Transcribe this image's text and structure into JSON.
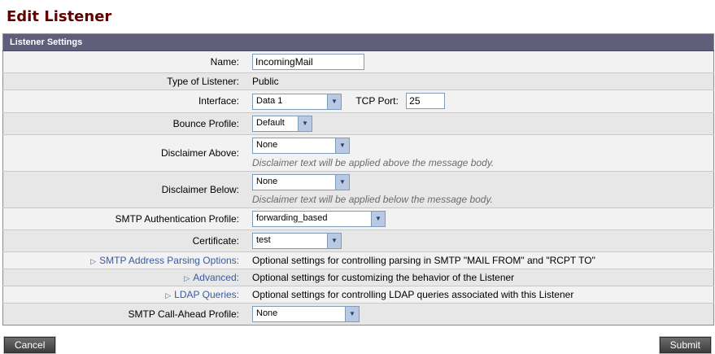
{
  "page": {
    "title": "Edit Listener"
  },
  "panel": {
    "header": "Listener Settings"
  },
  "rows": {
    "name": {
      "label": "Name:",
      "value": "IncomingMail"
    },
    "type": {
      "label": "Type of Listener:",
      "value": "Public"
    },
    "interface": {
      "label": "Interface:",
      "value": "Data 1",
      "tcp_label": "TCP Port:",
      "tcp_value": "25"
    },
    "bounce": {
      "label": "Bounce Profile:",
      "value": "Default"
    },
    "disclaimer_above": {
      "label": "Disclaimer Above:",
      "value": "None",
      "note": "Disclaimer text will be applied above the message body."
    },
    "disclaimer_below": {
      "label": "Disclaimer Below:",
      "value": "None",
      "note": "Disclaimer text will be applied below the message body."
    },
    "smtp_auth": {
      "label": "SMTP Authentication Profile:",
      "value": "forwarding_based"
    },
    "certificate": {
      "label": "Certificate:",
      "value": "test"
    },
    "parsing": {
      "label": "SMTP Address Parsing Options:",
      "desc": "Optional settings for controlling parsing in SMTP \"MAIL FROM\" and \"RCPT TO\""
    },
    "advanced": {
      "label": "Advanced:",
      "desc": "Optional settings for customizing the behavior of the Listener"
    },
    "ldap": {
      "label": "LDAP Queries:",
      "desc": "Optional settings for controlling LDAP queries associated with this Listener"
    },
    "call_ahead": {
      "label": "SMTP Call-Ahead Profile:",
      "value": "None"
    }
  },
  "buttons": {
    "cancel": "Cancel",
    "submit": "Submit"
  }
}
